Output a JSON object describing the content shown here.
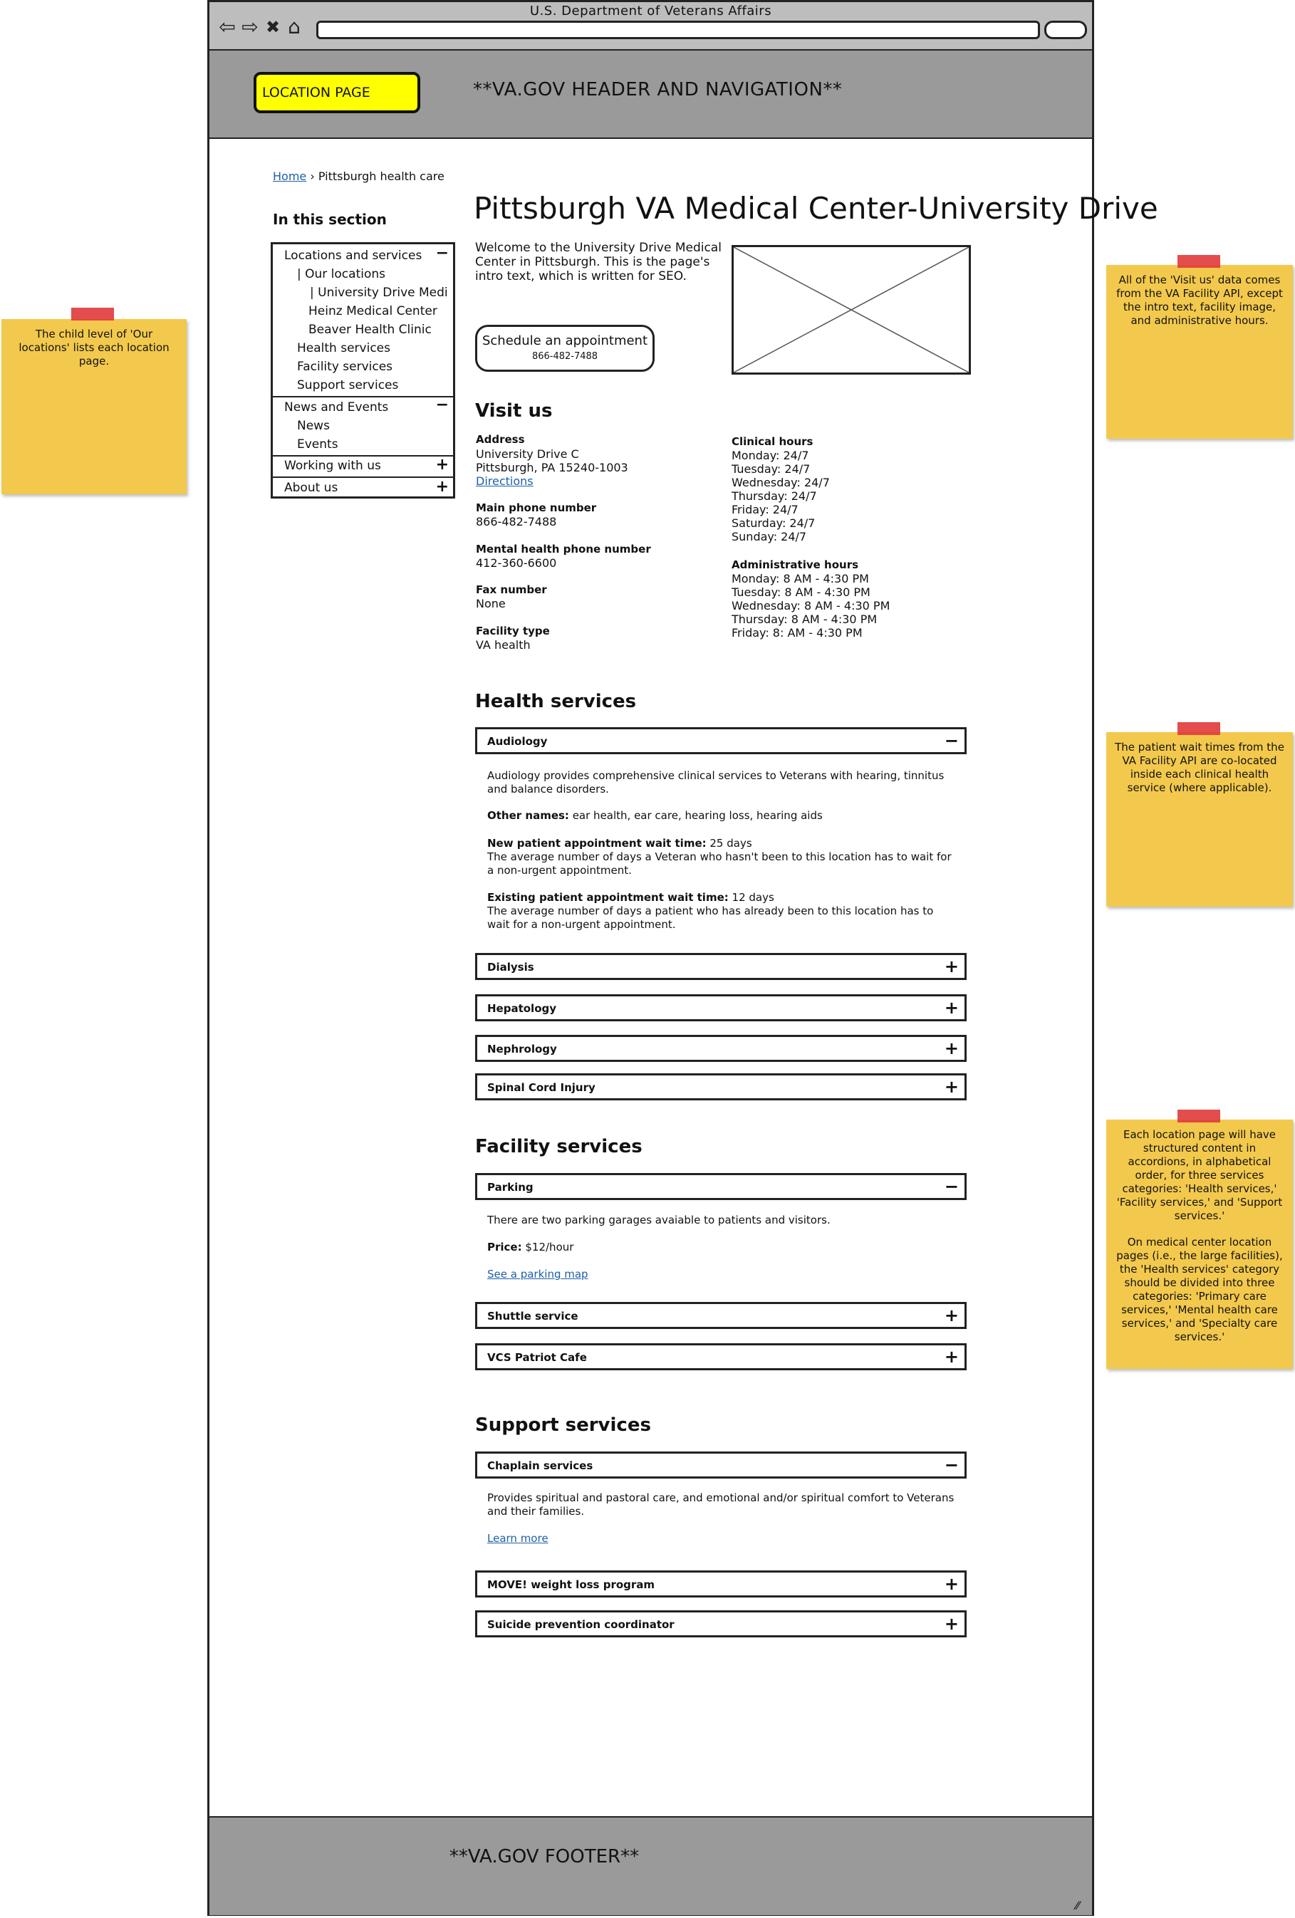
{
  "window": {
    "title": "U.S. Department of Veterans Affairs"
  },
  "header": {
    "badge": "LOCATION PAGE",
    "text": "**VA.GOV HEADER AND NAVIGATION**"
  },
  "footer": {
    "text": "**VA.GOV FOOTER**"
  },
  "breadcrumb": {
    "home": "Home",
    "separator": "›",
    "current": "Pittsburgh health care"
  },
  "page_title": "Pittsburgh VA Medical Center-University Drive",
  "sidebar": {
    "heading": "In this section",
    "items": [
      {
        "label": "Locations and services",
        "toggle": "−"
      },
      {
        "label": "| Our locations"
      },
      {
        "label": "| University Drive Medi"
      },
      {
        "label": "Heinz Medical Center"
      },
      {
        "label": "Beaver Health Clinic"
      },
      {
        "label": "Health services"
      },
      {
        "label": "Facility services"
      },
      {
        "label": "Support services"
      },
      {
        "label": "News and Events",
        "toggle": "−"
      },
      {
        "label": "News"
      },
      {
        "label": "Events"
      },
      {
        "label": "Working with us",
        "toggle": "+"
      },
      {
        "label": "About us",
        "toggle": "+"
      }
    ]
  },
  "intro": "Welcome to the University Drive Medical Center in Pittsburgh. This is the page's intro text, which is written for SEO.",
  "schedule": {
    "label": "Schedule an appointment",
    "phone": "866-482-7488"
  },
  "visit": {
    "heading": "Visit us",
    "address_label": "Address",
    "address_line1": "University Drive C",
    "address_line2": "Pittsburgh, PA 15240-1003",
    "directions": "Directions",
    "main_phone_label": "Main phone number",
    "main_phone": "866-482-7488",
    "mental_phone_label": "Mental health phone number",
    "mental_phone": "412-360-6600",
    "fax_label": "Fax number",
    "fax": "None",
    "type_label": "Facility type",
    "type": "VA health",
    "clinical_label": "Clinical hours",
    "clinical_hours": [
      "Monday: 24/7",
      "Tuesday: 24/7",
      "Wednesday: 24/7",
      "Thursday: 24/7",
      "Friday: 24/7",
      "Saturday: 24/7",
      "Sunday: 24/7"
    ],
    "admin_label": "Administrative hours",
    "admin_hours": [
      "Monday: 8 AM - 4:30 PM",
      "Tuesday: 8 AM - 4:30 PM",
      "Wednesday: 8 AM - 4:30 PM",
      "Thursday: 8 AM - 4:30 PM",
      "Friday: 8: AM - 4:30 PM"
    ]
  },
  "health": {
    "heading": "Health services",
    "open": {
      "title": "Audiology",
      "toggle": "−",
      "desc": "Audiology provides comprehensive clinical services to Veterans with hearing, tinnitus and balance disorders.",
      "other_label": "Other names:",
      "other_value": " ear health, ear care, hearing loss, hearing aids",
      "new_label": "New patient appointment wait time:",
      "new_value": " 25 days",
      "new_desc": "The average number of days a Veteran who hasn't been to this location has to wait for a non-urgent appointment.",
      "existing_label": "Existing patient appointment wait time:",
      "existing_value": " 12 days",
      "existing_desc": "The average number of days a patient who has already been to this location has to wait for a non-urgent appointment."
    },
    "closed": [
      "Dialysis",
      "Hepatology",
      "Nephrology",
      "Spinal Cord Injury"
    ]
  },
  "facility": {
    "heading": "Facility services",
    "open": {
      "title": "Parking",
      "toggle": "−",
      "desc": "There are two parking garages avaiable to patients and visitors.",
      "price_label": "Price:",
      "price_value": " $12/hour",
      "link": "See a parking map"
    },
    "closed": [
      "Shuttle service",
      "VCS Patriot Cafe"
    ]
  },
  "support": {
    "heading": "Support services",
    "open": {
      "title": "Chaplain services",
      "toggle": "−",
      "desc": "Provides spiritual and pastoral care, and emotional and/or spiritual comfort to Veterans and their families.",
      "link": "Learn more"
    },
    "closed": [
      "MOVE! weight loss program",
      "Suicide prevention coordinator"
    ]
  },
  "accordion_closed_toggle": "+",
  "notes": {
    "left": "The child level of 'Our locations' lists each location page.",
    "right1": "All of the 'Visit us' data comes from the VA Facility API, except the intro text, facility image, and administrative hours.",
    "right2": "The patient wait times from the VA Facility API are co-located inside each clinical health service (where applicable).",
    "right3a": "Each location page will have structured content in accordions, in alphabetical order, for three services categories: 'Health services,' 'Facility services,' and 'Support services.'",
    "right3b": "On medical center location pages (i.e., the large facilities), the 'Health services' category should be divided into three categories: 'Primary care services,' 'Mental health care services,' and 'Specialty care services.'"
  },
  "colors": {
    "header_bg": "#9a9a9a",
    "badge": "#ffff00",
    "sticky": "#f3c94d",
    "tape": "#e03a3a",
    "link": "#1f5fa8"
  }
}
